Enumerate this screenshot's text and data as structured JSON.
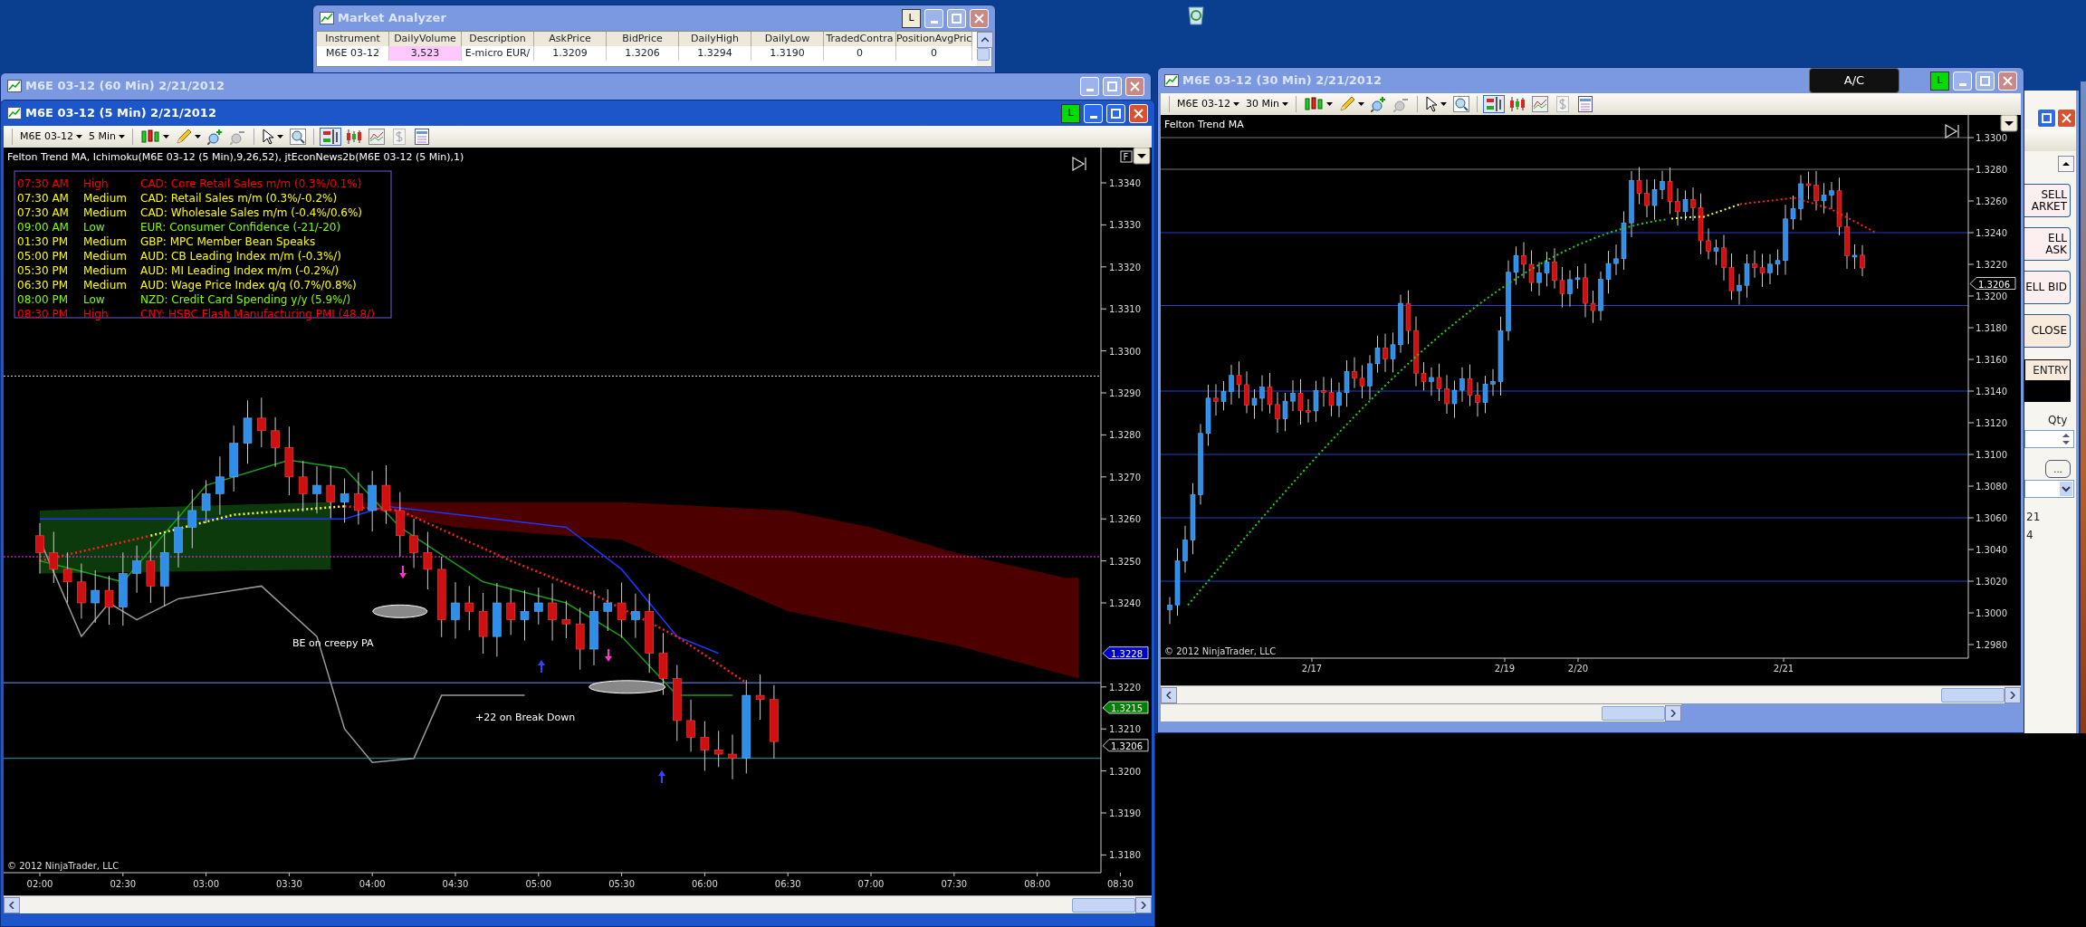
{
  "market_analyzer": {
    "title": "Market Analyzer",
    "lock_label": "L",
    "columns": [
      "Instrument",
      "DailyVolume",
      "Description",
      "AskPrice",
      "BidPrice",
      "DailyHigh",
      "DailyLow",
      "TradedContra",
      "PositionAvgPric"
    ],
    "rows": [
      [
        "M6E 03-12",
        "3,523",
        "E-micro EUR/",
        "1.3209",
        "1.3206",
        "1.3294",
        "1.3190",
        "0",
        "0"
      ]
    ]
  },
  "back_window": {
    "title": "M6E 03-12 (60 Min)  2/21/2012"
  },
  "chart_5min": {
    "title": "M6E 03-12 (5 Min)  2/21/2012",
    "lock_label": "L",
    "instrument": "M6E 03-12",
    "interval": "5 Min",
    "indicators": "Felton Trend MA,  Ichimoku(M6E 03-12 (5 Min),9,26,52), jtEconNews2b(M6E 03-12 (5 Min),1)",
    "news": [
      {
        "time": "07:30 AM",
        "impact": "High",
        "event": "CAD: Core Retail Sales m/m (0.3%/0.1%)",
        "color": "#ff0000"
      },
      {
        "time": "07:30 AM",
        "impact": "Medium",
        "event": "CAD: Retail Sales m/m (0.3%/-0.2%)",
        "color": "#ffff00"
      },
      {
        "time": "07:30 AM",
        "impact": "Medium",
        "event": "CAD: Wholesale Sales m/m (-0.4%/0.6%)",
        "color": "#ffff00"
      },
      {
        "time": "09:00 AM",
        "impact": "Low",
        "event": "EUR: Consumer Confidence (-21/-20)",
        "color": "#80ff00"
      },
      {
        "time": "01:30 PM",
        "impact": "Medium",
        "event": "GBP: MPC Member Bean Speaks",
        "color": "#ffff00"
      },
      {
        "time": "05:00 PM",
        "impact": "Medium",
        "event": "AUD: CB Leading Index m/m (-0.3%/)",
        "color": "#ffff00"
      },
      {
        "time": "05:30 PM",
        "impact": "Medium",
        "event": "AUD: MI Leading Index m/m (-0.2%/)",
        "color": "#ffff00"
      },
      {
        "time": "06:30 PM",
        "impact": "Medium",
        "event": "AUD: Wage Price Index q/q (0.7%/0.8%)",
        "color": "#ffff00"
      },
      {
        "time": "08:00 PM",
        "impact": "Low",
        "event": "NZD: Credit Card Spending y/y (5.9%/)",
        "color": "#80ff00"
      },
      {
        "time": "08:30 PM",
        "impact": "High",
        "event": "CNY: HSBC Flash Manufacturing PMI (48.8/)",
        "color": "#ff0000"
      }
    ],
    "price_ticks": [
      "1.3340",
      "1.3330",
      "1.3320",
      "1.3310",
      "1.3300",
      "1.3290",
      "1.3280",
      "1.3270",
      "1.3260",
      "1.3250",
      "1.3240",
      "1.3220",
      "1.3210",
      "1.3200",
      "1.3190",
      "1.3180"
    ],
    "price_markers": [
      {
        "value": "1.3228",
        "color": "#0000cc"
      },
      {
        "value": "1.3215",
        "color": "#008000"
      },
      {
        "value": "1.3206",
        "color": "#000000"
      }
    ],
    "time_ticks": [
      "02:00",
      "02:30",
      "03:00",
      "03:30",
      "04:00",
      "04:30",
      "05:00",
      "05:30",
      "06:00",
      "06:30",
      "07:00",
      "07:30",
      "08:00",
      "08:30"
    ],
    "annotations": [
      "BE on creepy PA",
      "+22 on Break Down"
    ],
    "f_label": "F",
    "copyright": "© 2012 NinjaTrader, LLC"
  },
  "chart_30min": {
    "title": "M6E 03-12 (30 Min)  2/21/2012",
    "lock_label": "L",
    "account_label": "A/C",
    "instrument": "M6E 03-12",
    "interval": "30 Min",
    "indicators": "Felton Trend MA",
    "price_ticks": [
      "1.3300",
      "1.3280",
      "1.3260",
      "1.3240",
      "1.3220",
      "1.3200",
      "1.3180",
      "1.3160",
      "1.3140",
      "1.3120",
      "1.3100",
      "1.3080",
      "1.3060",
      "1.3040",
      "1.3020",
      "1.3000",
      "1.2980"
    ],
    "price_markers": [
      {
        "value": "1.3206",
        "color": "#000000"
      }
    ],
    "date_ticks": [
      "2/17",
      "2/19",
      "2/20",
      "2/21"
    ],
    "copyright": "© 2012 NinjaTrader, LLC"
  },
  "order_panel": {
    "buttons": [
      {
        "label": "SELL",
        "label2": "ARKET"
      },
      {
        "label": "ELL ASK"
      },
      {
        "label": "ELL BID"
      },
      {
        "label": "CLOSE",
        "kind": "close"
      }
    ],
    "entry_label": "ENTRY",
    "qty_label": "Qty",
    "more_label": "...",
    "info_lines": [
      "21",
      "4"
    ]
  }
}
